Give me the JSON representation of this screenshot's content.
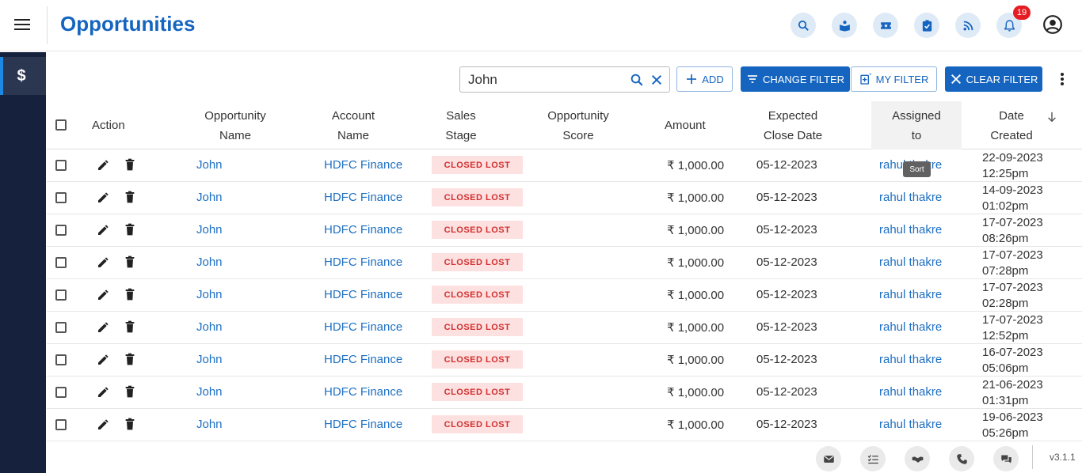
{
  "header": {
    "title": "Opportunities",
    "notification_count": "19",
    "icons": [
      "search-icon",
      "book-reader-icon",
      "ticket-icon",
      "clipboard-check-icon",
      "rss-icon",
      "bell-icon",
      "account-circle-icon"
    ]
  },
  "sidebar": {
    "items": [
      {
        "label": "$",
        "icon": "dollar-icon"
      }
    ]
  },
  "toolbar": {
    "search_value": "John",
    "search_placeholder": "Search",
    "add_label": "ADD",
    "change_filter_label": "CHANGE FILTER",
    "my_filter_label": "MY FILTER",
    "clear_filter_label": "CLEAR FILTER"
  },
  "table": {
    "columns": {
      "action": "Action",
      "opportunity_name": [
        "Opportunity",
        "Name"
      ],
      "account_name": [
        "Account",
        "Name"
      ],
      "sales_stage": [
        "Sales",
        "Stage"
      ],
      "opportunity_score": [
        "Opportunity",
        "Score"
      ],
      "amount": "Amount",
      "expected_close_date": [
        "Expected",
        "Close Date"
      ],
      "assigned_to": [
        "Assigned",
        "to"
      ],
      "date_created": [
        "Date",
        "Created"
      ]
    },
    "tooltip": "Sort",
    "rows": [
      {
        "name": "John",
        "account": "HDFC Finance",
        "stage": "CLOSED LOST",
        "score": "",
        "amount": "₹ 1,000.00",
        "close_date": "05-12-2023",
        "assigned": "rahul thakre",
        "created_date": "22-09-2023",
        "created_time": "12:25pm"
      },
      {
        "name": "John",
        "account": "HDFC Finance",
        "stage": "CLOSED LOST",
        "score": "",
        "amount": "₹ 1,000.00",
        "close_date": "05-12-2023",
        "assigned": "rahul thakre",
        "created_date": "14-09-2023",
        "created_time": "01:02pm"
      },
      {
        "name": "John",
        "account": "HDFC Finance",
        "stage": "CLOSED LOST",
        "score": "",
        "amount": "₹ 1,000.00",
        "close_date": "05-12-2023",
        "assigned": "rahul thakre",
        "created_date": "17-07-2023",
        "created_time": "08:26pm"
      },
      {
        "name": "John",
        "account": "HDFC Finance",
        "stage": "CLOSED LOST",
        "score": "",
        "amount": "₹ 1,000.00",
        "close_date": "05-12-2023",
        "assigned": "rahul thakre",
        "created_date": "17-07-2023",
        "created_time": "07:28pm"
      },
      {
        "name": "John",
        "account": "HDFC Finance",
        "stage": "CLOSED LOST",
        "score": "",
        "amount": "₹ 1,000.00",
        "close_date": "05-12-2023",
        "assigned": "rahul thakre",
        "created_date": "17-07-2023",
        "created_time": "02:28pm"
      },
      {
        "name": "John",
        "account": "HDFC Finance",
        "stage": "CLOSED LOST",
        "score": "",
        "amount": "₹ 1,000.00",
        "close_date": "05-12-2023",
        "assigned": "rahul thakre",
        "created_date": "17-07-2023",
        "created_time": "12:52pm"
      },
      {
        "name": "John",
        "account": "HDFC Finance",
        "stage": "CLOSED LOST",
        "score": "",
        "amount": "₹ 1,000.00",
        "close_date": "05-12-2023",
        "assigned": "rahul thakre",
        "created_date": "16-07-2023",
        "created_time": "05:06pm"
      },
      {
        "name": "John",
        "account": "HDFC Finance",
        "stage": "CLOSED LOST",
        "score": "",
        "amount": "₹ 1,000.00",
        "close_date": "05-12-2023",
        "assigned": "rahul thakre",
        "created_date": "21-06-2023",
        "created_time": "01:31pm"
      },
      {
        "name": "John",
        "account": "HDFC Finance",
        "stage": "CLOSED LOST",
        "score": "",
        "amount": "₹ 1,000.00",
        "close_date": "05-12-2023",
        "assigned": "rahul thakre",
        "created_date": "19-06-2023",
        "created_time": "05:26pm"
      }
    ]
  },
  "footer": {
    "icons": [
      "email-icon",
      "task-list-icon",
      "handshake-icon",
      "phone-icon",
      "chat-icon"
    ],
    "version": "v3.1.1"
  },
  "colors": {
    "brand": "#1565c0",
    "sidebar": "#16213e",
    "stage_bg": "#fde1e1",
    "stage_text": "#d32f2f",
    "badge": "#e51c23"
  }
}
